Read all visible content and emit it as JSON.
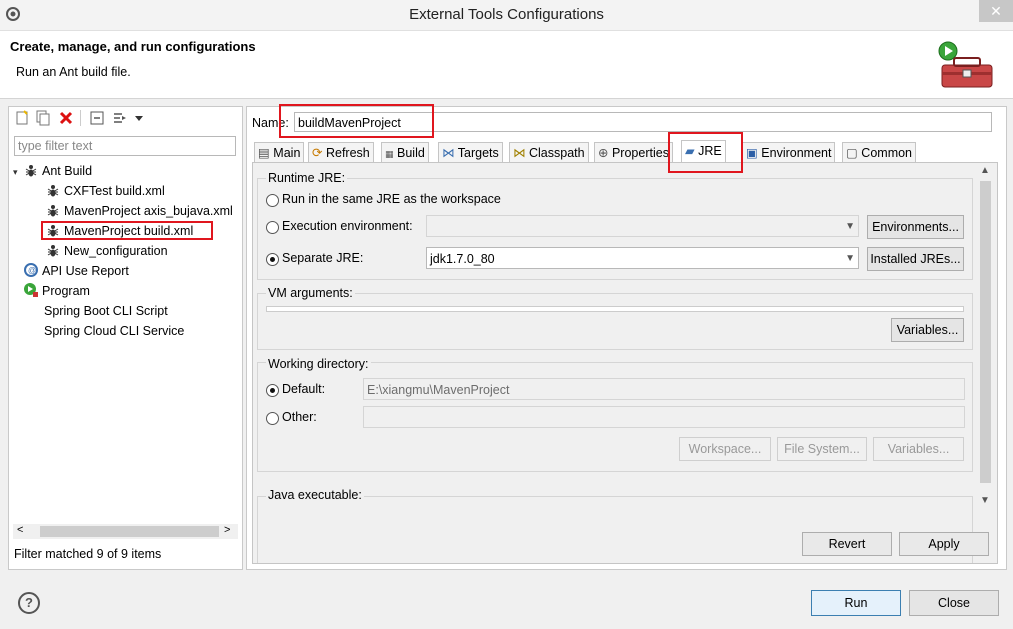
{
  "window": {
    "title": "External Tools Configurations",
    "close_glyph": "✕"
  },
  "header": {
    "title": "Create, manage, and run configurations",
    "description": "Run an Ant build file."
  },
  "left": {
    "filter_placeholder": "type filter text",
    "tree": [
      {
        "label": "Ant Build",
        "icon": "ant-icon",
        "level": 0,
        "expanded": true
      },
      {
        "label": "CXFTest build.xml",
        "icon": "ant-icon",
        "level": 1
      },
      {
        "label": "MavenProject axis_bujava.xml",
        "icon": "ant-icon",
        "level": 1
      },
      {
        "label": "MavenProject build.xml",
        "icon": "ant-icon",
        "level": 1,
        "selected": true
      },
      {
        "label": "New_configuration",
        "icon": "ant-icon",
        "level": 1
      },
      {
        "label": "API Use Report",
        "icon": "api-report-icon",
        "level": 0
      },
      {
        "label": "Program",
        "icon": "program-icon",
        "level": 0
      },
      {
        "label": "Spring Boot CLI Script",
        "icon": "",
        "level": 0
      },
      {
        "label": "Spring Cloud CLI Service",
        "icon": "",
        "level": 0
      }
    ],
    "status": "Filter matched 9 of 9 items"
  },
  "right": {
    "name_label": "Name:",
    "name_value": "buildMavenProject",
    "tabs": [
      {
        "label": "Main"
      },
      {
        "label": "Refresh"
      },
      {
        "label": "Build"
      },
      {
        "label": "Targets"
      },
      {
        "label": "Classpath"
      },
      {
        "label": "Properties"
      },
      {
        "label": "JRE",
        "active": true
      },
      {
        "label": "Environment"
      },
      {
        "label": "Common"
      }
    ],
    "jre": {
      "runtime_title": "Runtime JRE:",
      "opt_same": "Run in the same JRE as the workspace",
      "opt_exec": "Execution environment:",
      "environments_btn": "Environments...",
      "opt_separate": "Separate JRE:",
      "separate_value": "jdk1.7.0_80",
      "installed_btn": "Installed JREs...",
      "vm_title": "VM arguments:",
      "variables_btn": "Variables...",
      "wd_title": "Working directory:",
      "default_label": "Default:",
      "default_value": "E:\\xiangmu\\MavenProject",
      "other_label": "Other:",
      "workspace_btn": "Workspace...",
      "filesystem_btn": "File System...",
      "variables2_btn": "Variables...",
      "java_exec_title": "Java executable:"
    },
    "revert_btn": "Revert",
    "apply_btn": "Apply"
  },
  "footer": {
    "help": "?",
    "run_btn": "Run",
    "close_btn": "Close"
  },
  "colors": {
    "highlight": "#e0161e"
  }
}
